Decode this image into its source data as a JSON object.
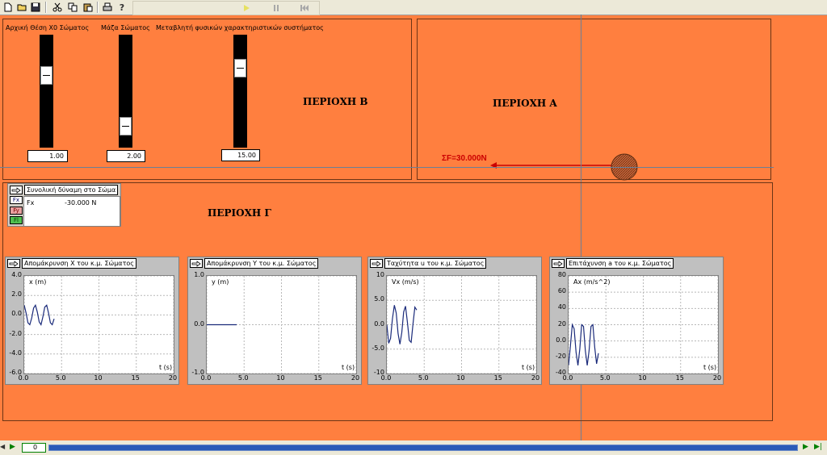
{
  "toolbar": {
    "icons": [
      "new-file-icon",
      "open-folder-icon",
      "save-icon",
      "cut-icon",
      "copy-icon",
      "paste-icon",
      "print-icon",
      "help-icon"
    ],
    "play": {
      "play_icon": "play-icon",
      "pause_icon": "pause-icon",
      "rewind_icon": "rewind-icon"
    }
  },
  "region_b": {
    "title": "ΠΕΡΙΟΧΗ Β",
    "sliders": [
      {
        "label": "Αρχική Θέση X0 Σώματος",
        "value": "1.00",
        "level": 0.62
      },
      {
        "label": "Μάζα Σώματος",
        "value": "2.00",
        "level": 0.18
      },
      {
        "label": "Μεταβλητή φυσικών χαρακτηριστικών συστήματος",
        "value": "15.00",
        "level": 0.7
      }
    ]
  },
  "region_a": {
    "title": "ΠΕΡΙΟΧΗ Α",
    "force_label": "ΣF=30.000N"
  },
  "region_c": {
    "title": "ΠΕΡΙΟΧΗ Γ",
    "force_panel": {
      "title": "Συνολική δύναμη στο Σώμα",
      "buttons": [
        "Fx",
        "Fy",
        "Fl"
      ],
      "row_label": "Fx",
      "row_value": "-30.000 N"
    }
  },
  "charts": [
    {
      "title": "Απομάκρυνση Χ του κ.μ. Σώματος",
      "ylabel": "x (m)",
      "xlabel": "t (s)",
      "yticks": [
        "4.0",
        "2.0",
        "0.0",
        "-2.0",
        "-4.0",
        "-6.0"
      ],
      "xticks": [
        "0.0",
        "5.0",
        "10",
        "15",
        "20"
      ]
    },
    {
      "title": "Απομάκρυνση Υ του κ.μ. Σώματος",
      "ylabel": "y (m)",
      "xlabel": "t (s)",
      "yticks": [
        "1.0",
        "0.0",
        "-1.0"
      ],
      "xticks": [
        "0.0",
        "5.0",
        "10",
        "15",
        "20"
      ]
    },
    {
      "title": "Ταχύτητα u του κ.μ. Σώματος",
      "ylabel": "Vx (m/s)",
      "xlabel": "t (s)",
      "yticks": [
        "10",
        "5.0",
        "0.0",
        "-5.0",
        "-10"
      ],
      "xticks": [
        "0.0",
        "5.0",
        "10",
        "15",
        "20"
      ]
    },
    {
      "title": "Επιτάχυνση a του κ.μ. Σώματος",
      "ylabel": "Ax (m/s^2)",
      "xlabel": "t (s)",
      "yticks": [
        "80",
        "60",
        "40",
        "20",
        "0.0",
        "-20",
        "-40"
      ],
      "xticks": [
        "0.0",
        "5.0",
        "10",
        "15",
        "20"
      ]
    }
  ],
  "chart_data": [
    {
      "type": "line",
      "ylim": [
        -6,
        4
      ],
      "xlim": [
        0,
        20
      ],
      "grid": true,
      "x": [
        0,
        0.25,
        0.5,
        0.75,
        1,
        1.25,
        1.5,
        1.75,
        2,
        2.25,
        2.5,
        2.75,
        3,
        3.25,
        3.5,
        3.75,
        4
      ],
      "series": [
        {
          "values": [
            1.0,
            0.2,
            -0.8,
            -1.0,
            -0.3,
            0.7,
            1.0,
            0.3,
            -0.7,
            -1.0,
            -0.2,
            0.8,
            1.0,
            0.2,
            -0.8,
            -1.0,
            -0.4
          ]
        }
      ]
    },
    {
      "type": "line",
      "ylim": [
        -1,
        1
      ],
      "xlim": [
        0,
        20
      ],
      "grid": true,
      "x": [
        0,
        4
      ],
      "series": [
        {
          "values": [
            0,
            0
          ]
        }
      ]
    },
    {
      "type": "line",
      "ylim": [
        -10,
        10
      ],
      "xlim": [
        0,
        20
      ],
      "grid": true,
      "x": [
        0,
        0.25,
        0.5,
        0.75,
        1,
        1.25,
        1.5,
        1.75,
        2,
        2.25,
        2.5,
        2.75,
        3,
        3.25,
        3.5,
        3.75,
        4
      ],
      "series": [
        {
          "values": [
            0,
            -3.8,
            -2.8,
            1.2,
            4.0,
            2.4,
            -1.8,
            -4.0,
            -1.6,
            2.6,
            3.8,
            0.6,
            -3.2,
            -3.6,
            0.2,
            3.6,
            3.0
          ]
        }
      ]
    },
    {
      "type": "line",
      "ylim": [
        -40,
        80
      ],
      "xlim": [
        0,
        20
      ],
      "grid": true,
      "x": [
        0,
        0.25,
        0.5,
        0.75,
        1,
        1.25,
        1.5,
        1.75,
        2,
        2.25,
        2.5,
        2.75,
        3,
        3.25,
        3.5,
        3.75,
        4
      ],
      "series": [
        {
          "values": [
            -30,
            -6,
            20,
            15,
            -14,
            -30,
            -10,
            20,
            18,
            -12,
            -30,
            -12,
            18,
            20,
            -8,
            -28,
            -15
          ]
        }
      ]
    }
  ],
  "bottombar": {
    "counter": "0"
  },
  "colors": {
    "background": "#ff7f3f",
    "force": "#cc0000",
    "line": "#1a2a7a"
  }
}
